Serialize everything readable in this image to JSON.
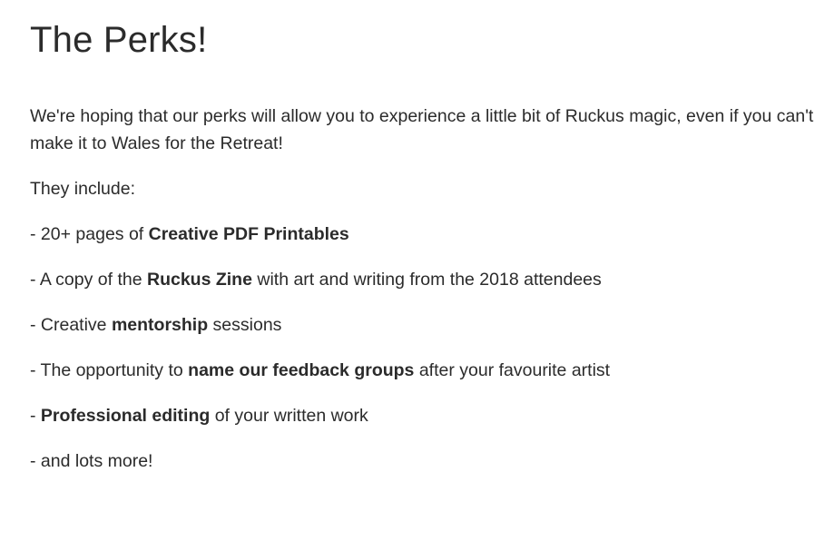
{
  "title": "The Perks!",
  "intro": "We're hoping that our perks will allow you to experience a little bit of Ruckus magic, even if you can't make it to Wales for the Retreat!",
  "includes_label": "They include:",
  "perks": [
    {
      "before": "- 20+ pages of ",
      "bold": "Creative PDF Printables",
      "after": ""
    },
    {
      "before": "- A copy of the ",
      "bold": "Ruckus Zine",
      "after": " with art and writing from the 2018 attendees"
    },
    {
      "before": "- Creative ",
      "bold": "mentorship",
      "after": " sessions"
    },
    {
      "before": "- The opportunity to ",
      "bold": "name our feedback groups",
      "after": " after your favourite artist"
    },
    {
      "before": "- ",
      "bold": "Professional editing",
      "after": " of your written work"
    },
    {
      "before": "- and lots more!",
      "bold": "",
      "after": ""
    }
  ]
}
